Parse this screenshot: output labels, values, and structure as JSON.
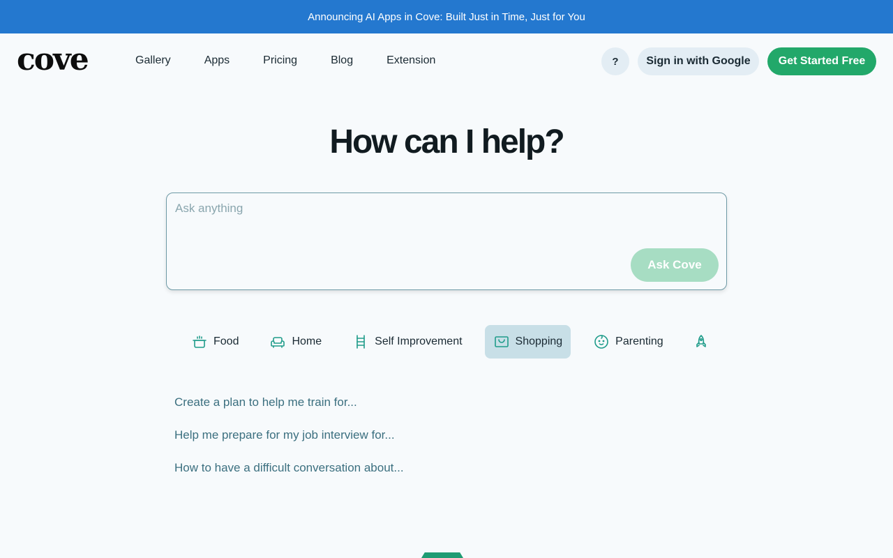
{
  "banner": {
    "text": "Announcing AI Apps in Cove: Built Just in Time, Just for You"
  },
  "header": {
    "logo": "cove",
    "nav": [
      "Gallery",
      "Apps",
      "Pricing",
      "Blog",
      "Extension"
    ],
    "help_label": "?",
    "signin_label": "Sign in with Google",
    "cta_label": "Get Started Free"
  },
  "hero": {
    "title": "How can I help?"
  },
  "ask": {
    "placeholder": "Ask anything",
    "button_label": "Ask Cove"
  },
  "categories": [
    {
      "label": "Food",
      "icon": "pot-icon"
    },
    {
      "label": "Home",
      "icon": "sofa-icon"
    },
    {
      "label": "Self Improvement",
      "icon": "ladder-icon"
    },
    {
      "label": "Shopping",
      "icon": "shopping-bag-icon",
      "selected": true
    },
    {
      "label": "Parenting",
      "icon": "baby-face-icon"
    },
    {
      "label": "",
      "icon": "rocket-icon"
    }
  ],
  "suggestions": [
    "Create a plan to help me train for...",
    "Help me prepare for my job interview for...",
    "How to have a difficult conversation about..."
  ],
  "colors": {
    "banner": "#2478cf",
    "accent_green": "#22a86a",
    "icon_teal": "#1f9c8a",
    "selected_category": "#c8dfe7"
  }
}
